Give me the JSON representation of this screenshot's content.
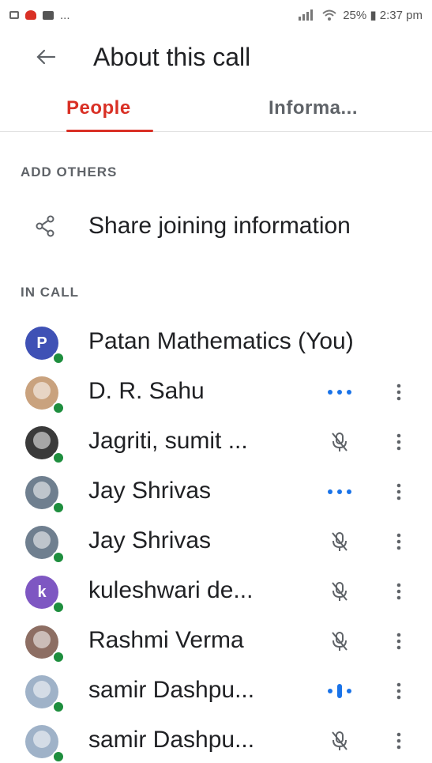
{
  "status_bar": {
    "right_text": "25% ▮ 2:37 pm",
    "left_icons": [
      "screen-icon",
      "app-notification-icon",
      "message-icon"
    ],
    "more": "..."
  },
  "header": {
    "title": "About this call"
  },
  "tabs": [
    {
      "label": "People",
      "active": true
    },
    {
      "label": "Informa..."
    }
  ],
  "sections": {
    "add_others": "ADD OTHERS",
    "in_call": "IN CALL"
  },
  "share": {
    "label": "Share joining information"
  },
  "participants": [
    {
      "name": "Patan Mathematics (You)",
      "avatar_letter": "P",
      "avatar_color": "#3f51b5",
      "status": "none"
    },
    {
      "name": "D. R. Sahu",
      "avatar_color": "#c9a27e",
      "status": "dots"
    },
    {
      "name": "Jagriti, sumit ...",
      "avatar_color": "#3a3a3a",
      "status": "muted"
    },
    {
      "name": "Jay Shrivas",
      "avatar_color": "#6f7f8f",
      "status": "dots"
    },
    {
      "name": "Jay Shrivas",
      "avatar_color": "#6f7f8f",
      "status": "muted"
    },
    {
      "name": "kuleshwari de...",
      "avatar_letter": "k",
      "avatar_color": "#7e57c2",
      "status": "muted"
    },
    {
      "name": "Rashmi Verma",
      "avatar_color": "#8d6e63",
      "status": "muted"
    },
    {
      "name": "samir Dashpu...",
      "avatar_color": "#9fb2c8",
      "status": "speaking"
    },
    {
      "name": "samir Dashpu...",
      "avatar_color": "#9fb2c8",
      "status": "muted"
    }
  ],
  "colors": {
    "accent": "#d93025",
    "blue": "#1a73e8",
    "presence": "#1e8e3e"
  }
}
